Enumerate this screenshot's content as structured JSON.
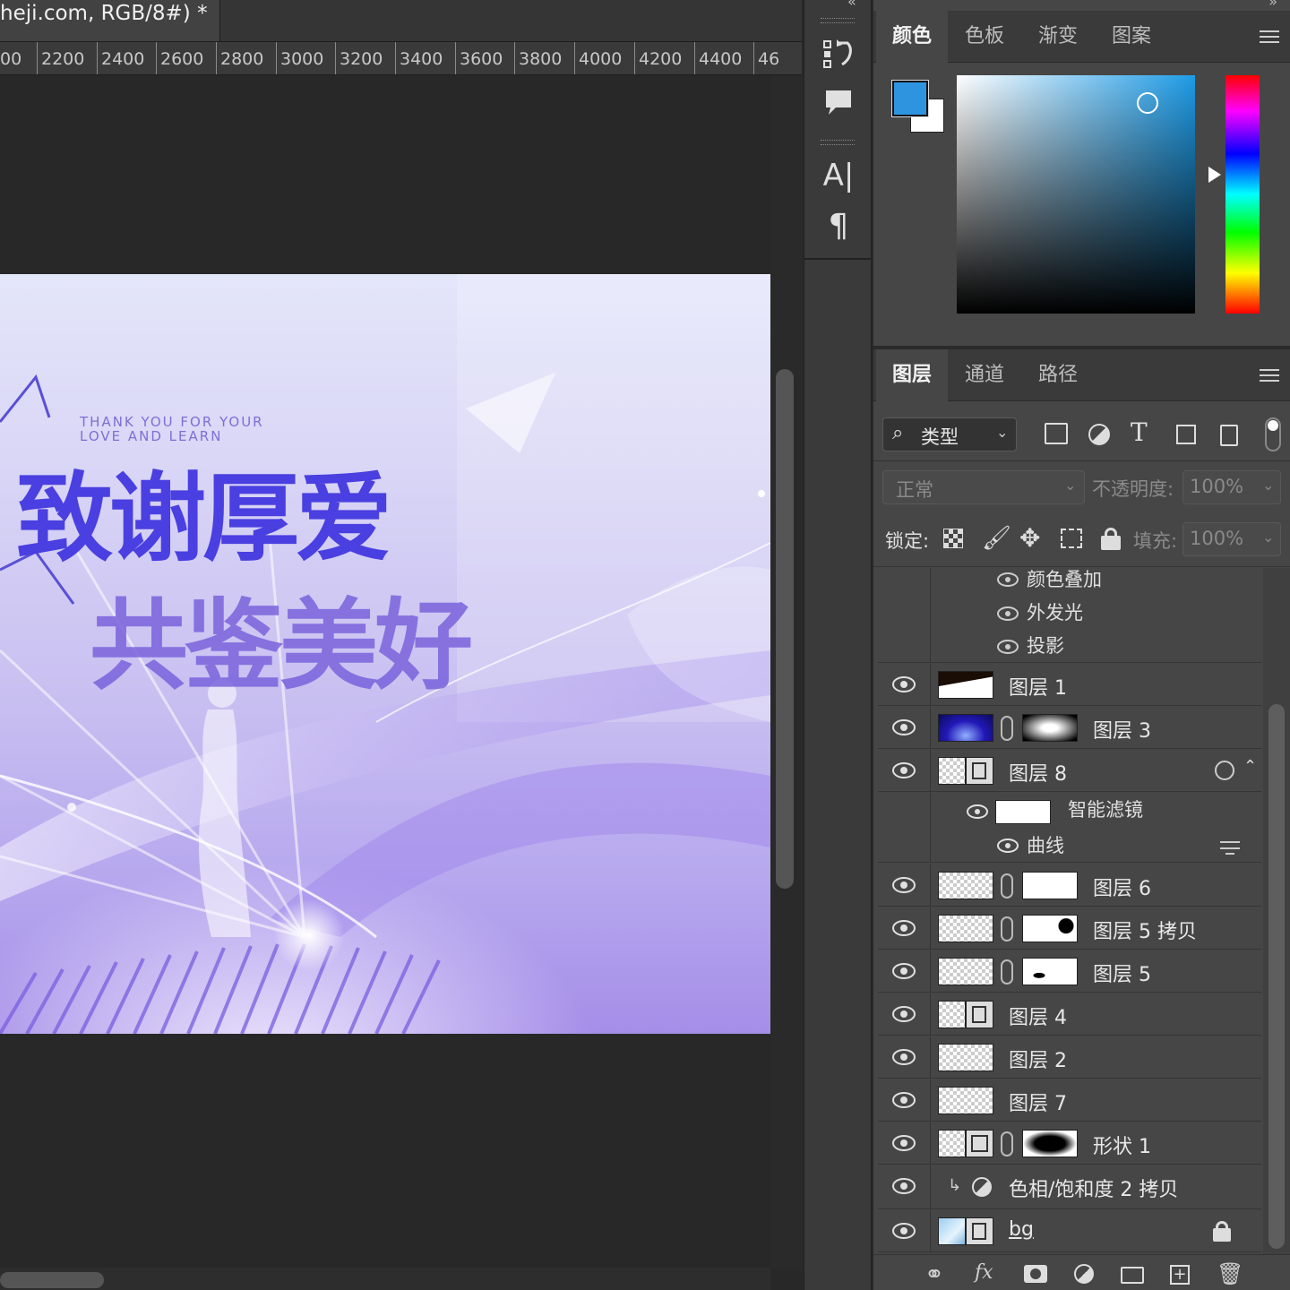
{
  "document": {
    "tab_title": "heji.com, RGB/8#) *",
    "ruler_ticks": [
      "00",
      "2200",
      "2400",
      "2600",
      "2800",
      "3000",
      "3200",
      "3400",
      "3600",
      "3800",
      "4000",
      "4200",
      "4400",
      "46"
    ]
  },
  "artwork": {
    "english_line1": "THANK YOU FOR YOUR",
    "english_line2": "LOVE AND LEARN",
    "headline1": "致谢厚爱",
    "headline2": "共鉴美好"
  },
  "toolbar": {
    "icons": [
      "history-icon",
      "comment-icon",
      "character-icon",
      "paragraph-icon"
    ],
    "character_glyph": "A|",
    "paragraph_glyph": "¶"
  },
  "color_panel": {
    "tabs": [
      "颜色",
      "色板",
      "渐变",
      "图案"
    ],
    "active_tab": "颜色",
    "foreground_color": "#2f94e0",
    "background_color": "#ffffff"
  },
  "layers_panel": {
    "tabs": [
      "图层",
      "通道",
      "路径"
    ],
    "active_tab": "图层",
    "filter_label": "类型",
    "blend_mode": "正常",
    "opacity_label": "不透明度:",
    "opacity_value": "100%",
    "lock_label": "锁定:",
    "fill_label": "填充:",
    "fill_value": "100%",
    "effects": [
      "颜色叠加",
      "外发光",
      "投影"
    ],
    "layers": [
      {
        "name": "图层 1"
      },
      {
        "name": "图层 3"
      },
      {
        "name": "图层 8"
      },
      {
        "name": "图层 6"
      },
      {
        "name": "图层 5 拷贝"
      },
      {
        "name": "图层 5"
      },
      {
        "name": "图层 4"
      },
      {
        "name": "图层 2"
      },
      {
        "name": "图层 7"
      },
      {
        "name": "形状 1"
      },
      {
        "name": "色相/饱和度 2 拷贝"
      },
      {
        "name": "bg"
      }
    ],
    "smart_filter_label": "智能滤镜",
    "curves_label": "曲线",
    "bottom_icons": [
      "link-icon",
      "fx-icon",
      "mask-icon",
      "adjustment-icon",
      "folder-icon",
      "new-layer-icon",
      "trash-icon"
    ],
    "fx_glyph": "fx"
  }
}
